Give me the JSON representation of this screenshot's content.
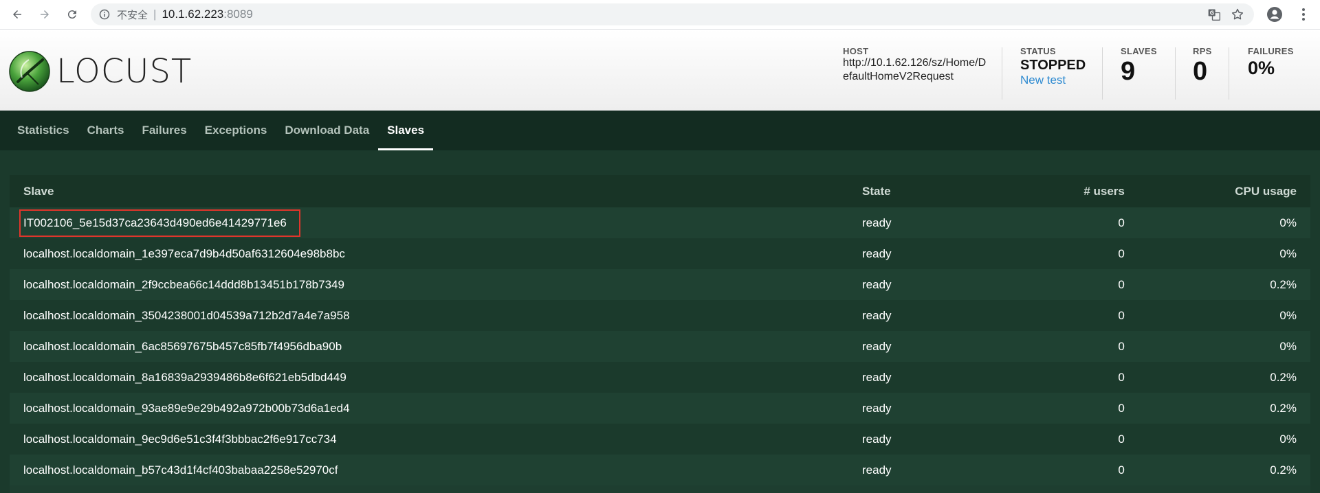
{
  "browser": {
    "insecure_label": "不安全",
    "separator": "|",
    "url_host": "10.1.62.223",
    "url_port": ":8089"
  },
  "header": {
    "logo_text": "LOCUST",
    "host_label": "HOST",
    "host_value": "http://10.1.62.126/sz/Home/DefaultHomeV2Request",
    "status_label": "STATUS",
    "status_value": "STOPPED",
    "new_test_link": "New test",
    "slaves_label": "SLAVES",
    "slaves_value": "9",
    "rps_label": "RPS",
    "rps_value": "0",
    "failures_label": "FAILURES",
    "failures_value": "0%"
  },
  "tabs": [
    {
      "label": "Statistics",
      "active": false
    },
    {
      "label": "Charts",
      "active": false
    },
    {
      "label": "Failures",
      "active": false
    },
    {
      "label": "Exceptions",
      "active": false
    },
    {
      "label": "Download Data",
      "active": false
    },
    {
      "label": "Slaves",
      "active": true
    }
  ],
  "table": {
    "columns": [
      "Slave",
      "State",
      "# users",
      "CPU usage"
    ],
    "rows": [
      {
        "slave": "IT002106_5e15d37ca23643d490ed6e41429771e6",
        "state": "ready",
        "users": "0",
        "cpu": "0%",
        "highlighted": true
      },
      {
        "slave": "localhost.localdomain_1e397eca7d9b4d50af6312604e98b8bc",
        "state": "ready",
        "users": "0",
        "cpu": "0%"
      },
      {
        "slave": "localhost.localdomain_2f9ccbea66c14ddd8b13451b178b7349",
        "state": "ready",
        "users": "0",
        "cpu": "0.2%"
      },
      {
        "slave": "localhost.localdomain_3504238001d04539a712b2d7a4e7a958",
        "state": "ready",
        "users": "0",
        "cpu": "0%"
      },
      {
        "slave": "localhost.localdomain_6ac85697675b457c85fb7f4956dba90b",
        "state": "ready",
        "users": "0",
        "cpu": "0%"
      },
      {
        "slave": "localhost.localdomain_8a16839a2939486b8e6f621eb5dbd449",
        "state": "ready",
        "users": "0",
        "cpu": "0.2%"
      },
      {
        "slave": "localhost.localdomain_93ae89e9e29b492a972b00b73d6a1ed4",
        "state": "ready",
        "users": "0",
        "cpu": "0.2%"
      },
      {
        "slave": "localhost.localdomain_9ec9d6e51c3f4f3bbbac2f6e917cc734",
        "state": "ready",
        "users": "0",
        "cpu": "0%"
      },
      {
        "slave": "localhost.localdomain_b57c43d1f4cf403babaa2258e52970cf",
        "state": "ready",
        "users": "0",
        "cpu": "0.2%"
      }
    ]
  },
  "colors": {
    "page_bg": "#1b3a2c",
    "tab_bar_bg": "#132c21",
    "link_blue": "#2f8bd1",
    "highlight_red": "#e0352b"
  }
}
